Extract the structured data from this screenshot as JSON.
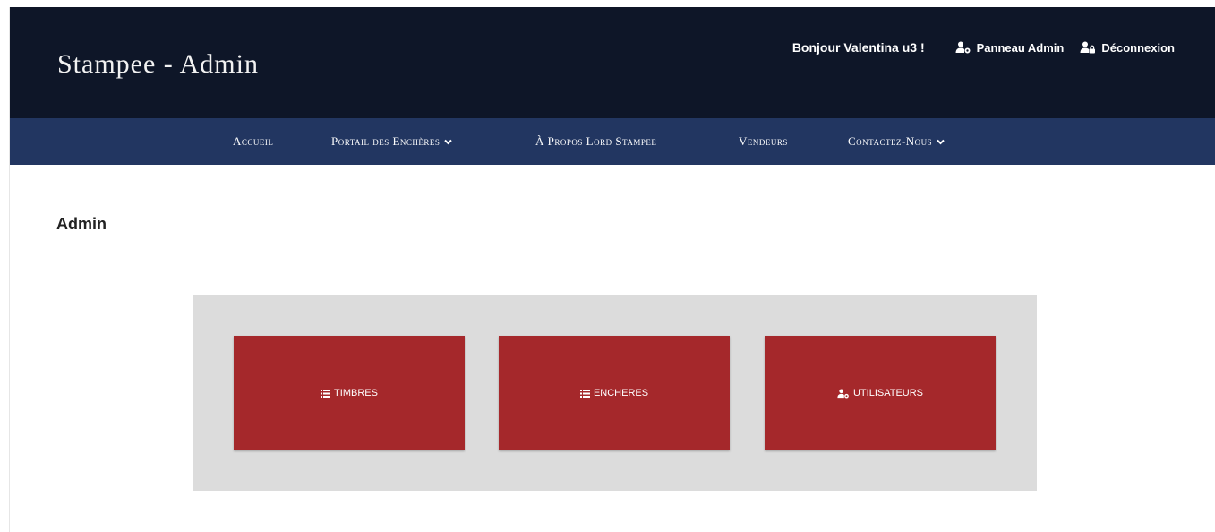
{
  "header": {
    "brand": "Stampee - Admin",
    "greeting": "Bonjour Valentina u3 !",
    "links": [
      {
        "label": "Panneau Admin",
        "icon": "user-cog-icon"
      },
      {
        "label": "Déconnexion",
        "icon": "user-lock-icon"
      }
    ]
  },
  "nav": {
    "items": [
      {
        "label": "Accueil"
      },
      {
        "label": "Portail des Enchères",
        "dropdown": true
      },
      {
        "label": "À Propos Lord Stampee"
      },
      {
        "label": "Vendeurs"
      },
      {
        "label": "Contactez-Nous",
        "dropdown": true
      }
    ]
  },
  "main": {
    "title": "Admin",
    "tiles": [
      {
        "label": "TIMBRES",
        "icon": "list-icon"
      },
      {
        "label": "ENCHERES",
        "icon": "list-icon"
      },
      {
        "label": "UTILISATEURS",
        "icon": "user-cog-icon"
      }
    ]
  },
  "colors": {
    "header_bg": "#0e1628",
    "nav_bg": "#223661",
    "tile_bg": "#a5282b",
    "panel_bg": "#dcdcdc"
  }
}
